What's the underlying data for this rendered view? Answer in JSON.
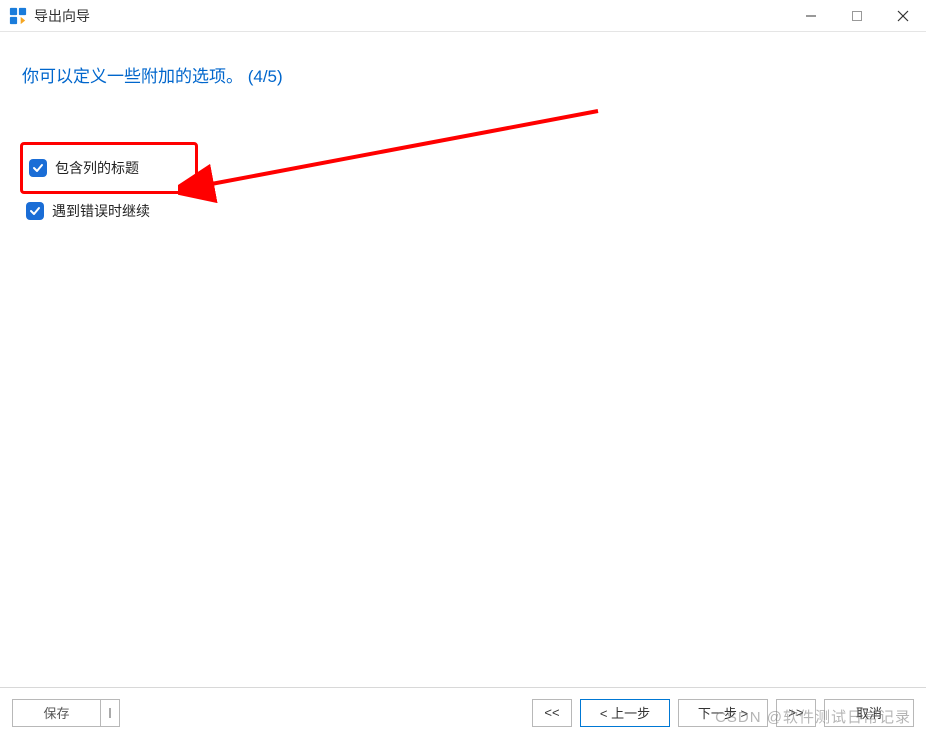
{
  "titlebar": {
    "title": "导出向导"
  },
  "content": {
    "headline": "你可以定义一些附加的选项。 (4/5)",
    "options": {
      "include_column_titles": {
        "label": "包含列的标题",
        "checked": true
      },
      "continue_on_error": {
        "label": "遇到错误时继续",
        "checked": true
      }
    }
  },
  "footer": {
    "save": "保存",
    "first": "<<",
    "prev": "< 上一步",
    "next": "下一步 >",
    "last": ">>",
    "cancel": "取消"
  },
  "watermark": "CSDN @软件测试日常记录"
}
